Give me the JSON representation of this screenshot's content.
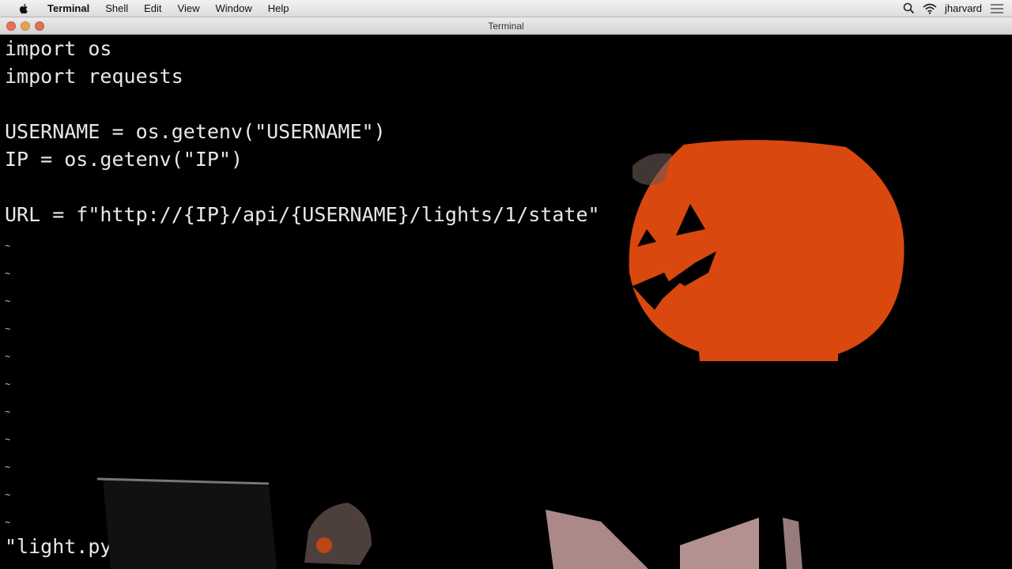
{
  "menubar": {
    "app_name": "Terminal",
    "items": [
      "Shell",
      "Edit",
      "View",
      "Window",
      "Help"
    ],
    "user": "jharvard"
  },
  "window": {
    "title": "Terminal"
  },
  "editor": {
    "lines": [
      "import os",
      "import requests",
      "",
      "USERNAME = os.getenv(\"USERNAME\")",
      "IP = os.getenv(\"IP\")",
      "",
      "URL = f\"http://{IP}/api/{USERNAME}/lights/1/state\""
    ],
    "tilde_char": "~",
    "status_line": "\"light.py"
  },
  "colors": {
    "terminal_bg": "#000000",
    "text": "#e8e8e8",
    "pumpkin": "#d9480f"
  },
  "icons": [
    "apple-icon",
    "search-icon",
    "wifi-icon",
    "menu-icon"
  ]
}
